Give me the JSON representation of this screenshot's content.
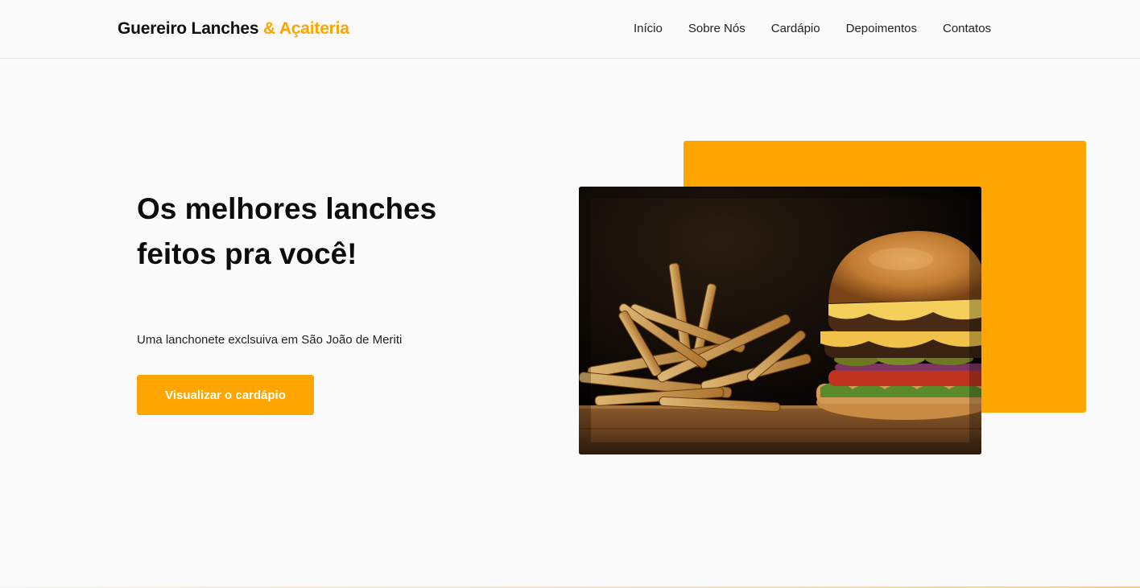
{
  "header": {
    "brand": {
      "main": "Guereiro Lanches",
      "accent": "& Açaiteria"
    },
    "nav": [
      {
        "label": "Início"
      },
      {
        "label": "Sobre Nós"
      },
      {
        "label": "Cardápio"
      },
      {
        "label": "Depoimentos"
      },
      {
        "label": "Contatos"
      }
    ]
  },
  "hero": {
    "title": "Os melhores lanches feitos pra você!",
    "subtitle": "Uma lanchonete exclsuiva em São João de Meriti",
    "cta_label": "Visualizar o cardápio"
  },
  "image": {
    "alt": "burger-and-fries-photo"
  },
  "colors": {
    "accent": "#ffa500",
    "background": "#fafafa",
    "text": "#111111"
  }
}
